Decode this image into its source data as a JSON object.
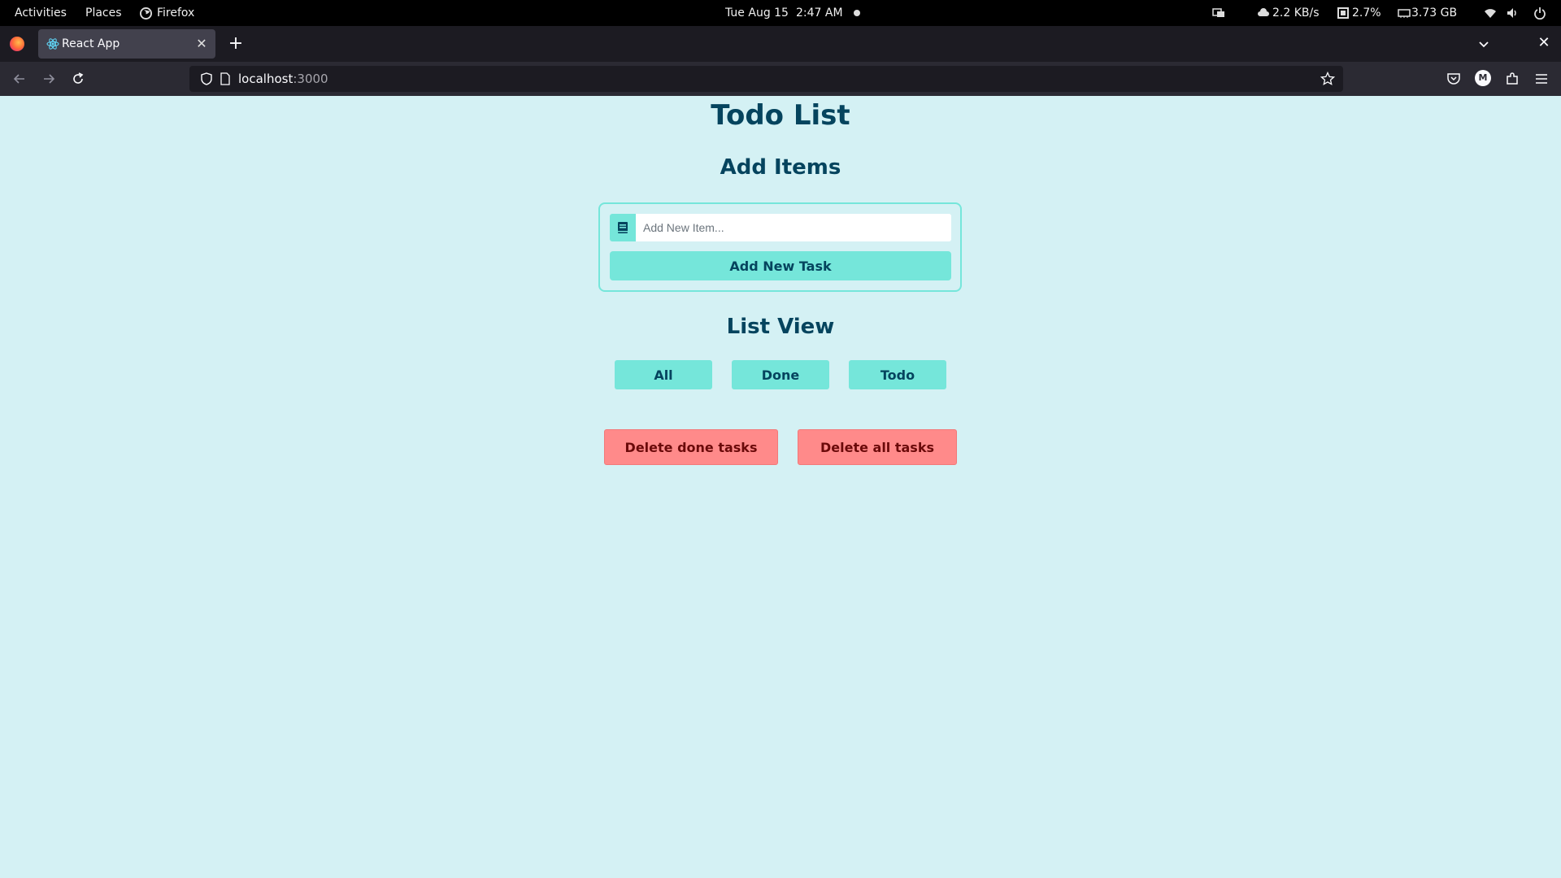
{
  "topbar": {
    "activities": "Activities",
    "places": "Places",
    "app_name": "Firefox",
    "date": "Tue Aug 15",
    "time": "2:47 AM",
    "net_speed": "2.2 KB/s",
    "cpu": "2.7%",
    "memory": "3.73 GB"
  },
  "browser": {
    "tab_title": "React App",
    "url_host": "localhost",
    "url_port": ":3000"
  },
  "app": {
    "title": "Todo List",
    "add_heading": "Add Items",
    "input_placeholder": "Add New Item...",
    "add_button": "Add New Task",
    "list_heading": "List View",
    "filters": [
      "All",
      "Done",
      "Todo"
    ],
    "delete_done": "Delete done tasks",
    "delete_all": "Delete all tasks"
  },
  "colors": {
    "background": "#d4f1f4",
    "accent": "#75e6da",
    "text": "#05445e",
    "danger": "#ff8a8a"
  }
}
